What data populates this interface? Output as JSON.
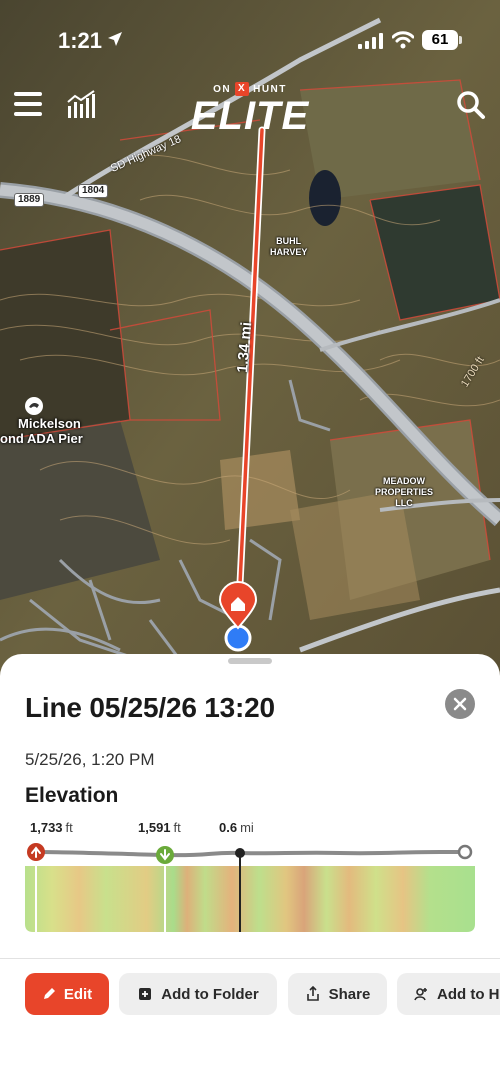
{
  "status": {
    "time": "1:21",
    "battery": "61"
  },
  "brand": {
    "top_left": "ON",
    "top_mark": "X",
    "top_right": "HUNT",
    "main": "ELITE"
  },
  "map": {
    "labels": {
      "buhl_harvey": "BUHL\nHARVEY",
      "meadow": "MEADOW\nPROPERTIES\nLLC",
      "poi_line1": "Mickelson",
      "poi_line2": "ond ADA Pier",
      "road_badge_1": "1889",
      "road_badge_2": "1804",
      "road_name": "SD Highway 18",
      "contour": "1700 ft",
      "distance": "1.34 mi",
      "home_pin": "Home"
    },
    "line_color": "#e8452a"
  },
  "sheet": {
    "title": "Line 05/25/26 13:20",
    "date": "5/25/26, 1:20 PM",
    "elevation_heading": "Elevation",
    "max_elevation": "1,733",
    "min_elevation": "1,591",
    "elevation_unit": "ft",
    "cursor_distance": "0.6",
    "distance_unit": "mi"
  },
  "actions": {
    "edit": "Edit",
    "add_to_folder": "Add to Folder",
    "share": "Share",
    "add_to_h": "Add to H"
  }
}
